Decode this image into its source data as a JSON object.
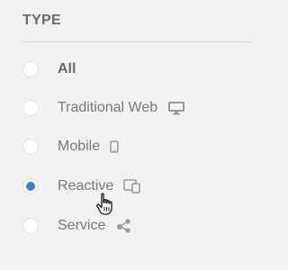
{
  "section": {
    "title": "TYPE"
  },
  "options": [
    {
      "label": "All",
      "selected": false,
      "icon": null
    },
    {
      "label": "Traditional Web",
      "selected": false,
      "icon": "desktop-monitor-icon"
    },
    {
      "label": "Mobile",
      "selected": false,
      "icon": "mobile-phone-icon"
    },
    {
      "label": "Reactive",
      "selected": true,
      "icon": "responsive-devices-icon"
    },
    {
      "label": "Service",
      "selected": false,
      "icon": "service-nodes-icon"
    }
  ],
  "colors": {
    "background": "#f2f2f2",
    "selected_dot": "#3f7bcf",
    "text": "#7a7a7a",
    "icon": "#9a9a9a"
  },
  "cursor": "hand-pointer-cursor-icon"
}
